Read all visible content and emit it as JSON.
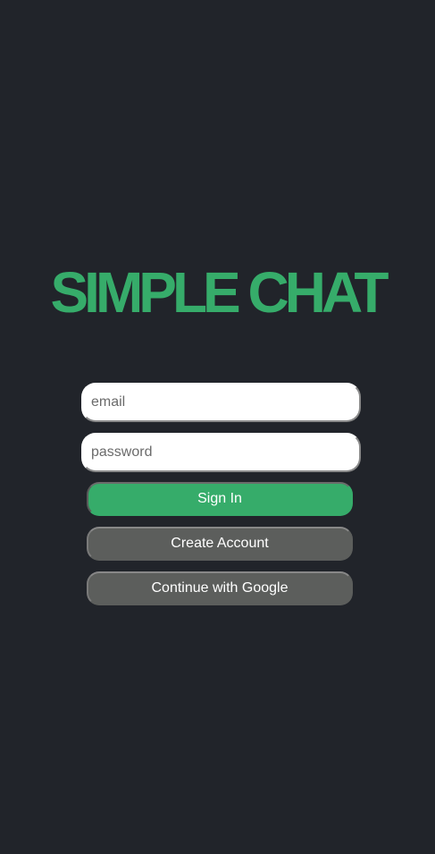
{
  "app": {
    "title": "SIMPLE CHAT"
  },
  "login_form": {
    "email": {
      "value": "",
      "placeholder": "email"
    },
    "password": {
      "value": "",
      "placeholder": "password"
    },
    "sign_in_label": "Sign In",
    "create_account_label": "Create Account",
    "google_label": "Continue with Google"
  },
  "colors": {
    "background": "#21242a",
    "brand_green": "#36ac6a",
    "secondary_button": "#5c5e5c",
    "field_background": "#ffffff",
    "button_text": "#ffffff"
  }
}
